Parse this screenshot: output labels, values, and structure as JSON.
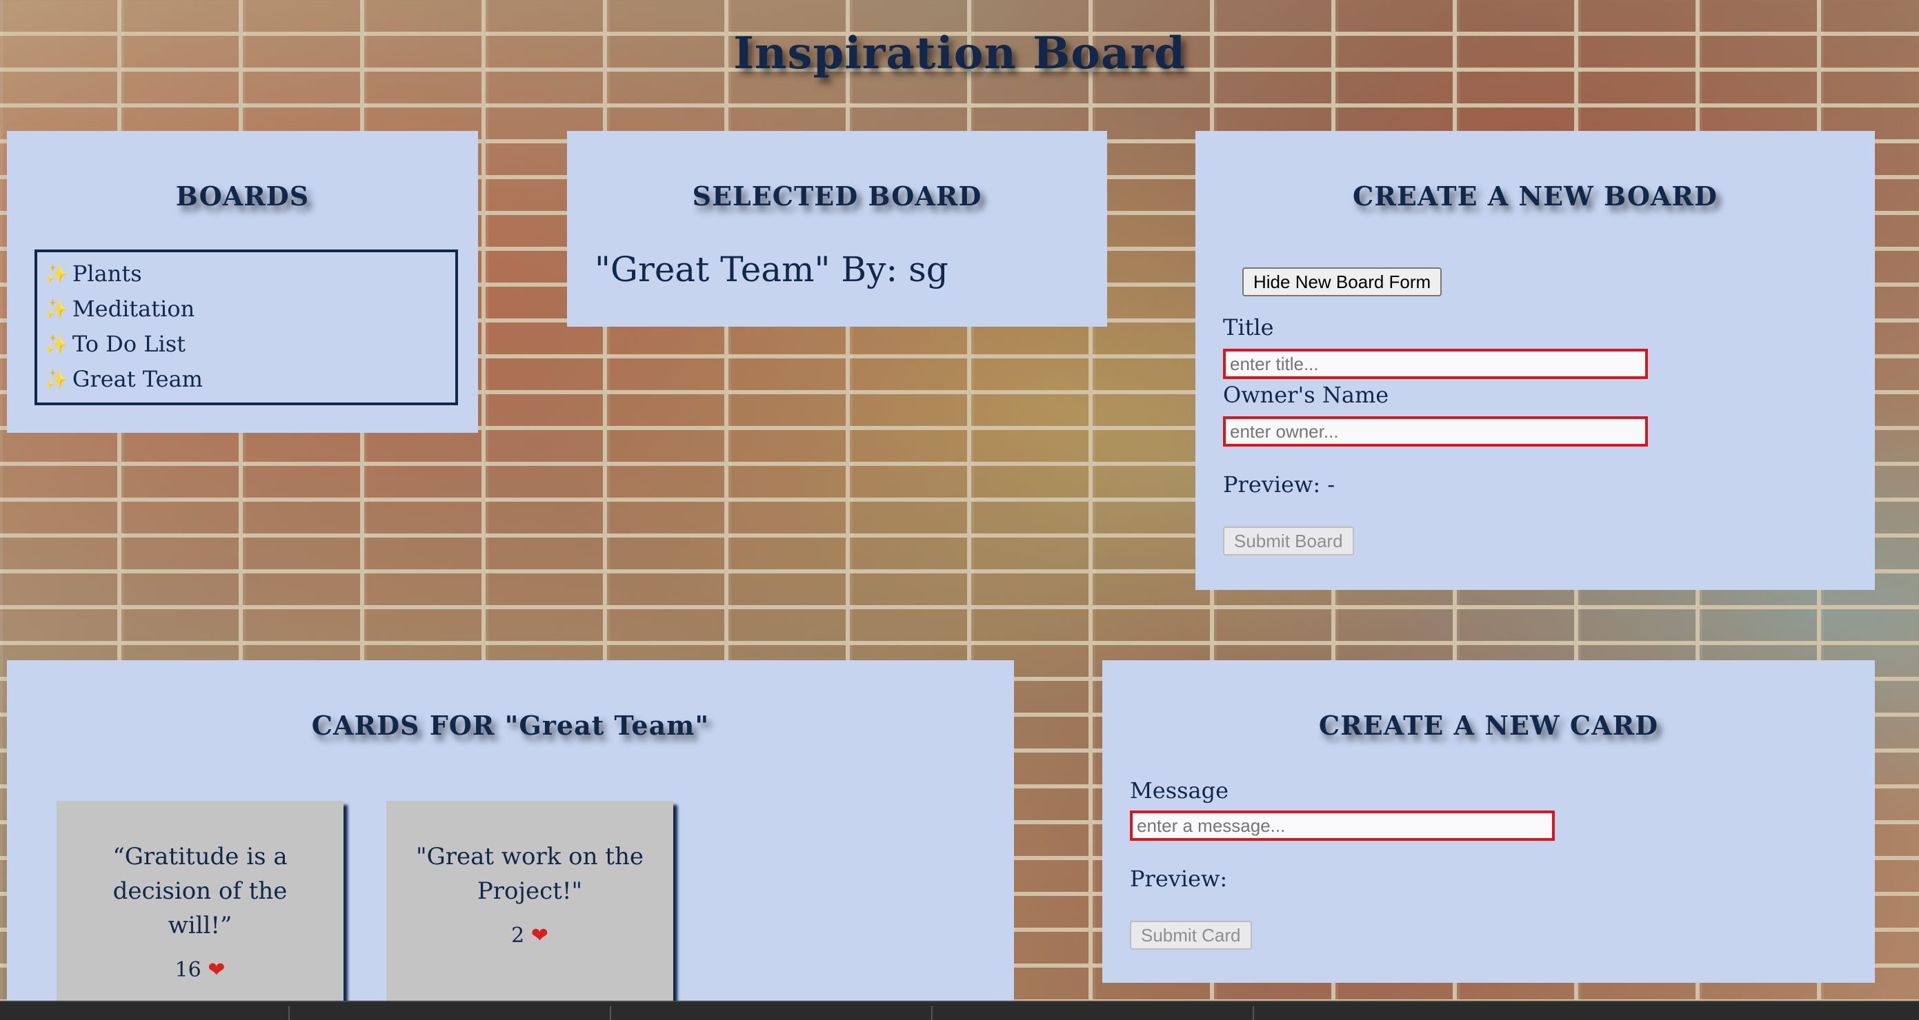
{
  "app_title": "Inspiration Board",
  "boards_panel": {
    "heading": "BOARDS",
    "items": [
      {
        "icon": "sparkles-icon",
        "label": "Plants"
      },
      {
        "icon": "sparkles-icon",
        "label": "Meditation"
      },
      {
        "icon": "sparkles-icon",
        "label": "To Do List"
      },
      {
        "icon": "sparkles-icon",
        "label": "Great Team"
      }
    ]
  },
  "selected_panel": {
    "heading": "SELECTED BOARD",
    "text": "\"Great Team\" By: sg"
  },
  "create_board": {
    "heading": "CREATE A NEW BOARD",
    "toggle_label": "Hide New Board Form",
    "title_label": "Title",
    "title_value": "",
    "title_placeholder": "enter title...",
    "owner_label": "Owner's Name",
    "owner_value": "",
    "owner_placeholder": "enter owner...",
    "preview": "Preview: -",
    "submit_label": "Submit Board"
  },
  "cards_panel": {
    "heading": "CARDS FOR \"Great Team\"",
    "cards": [
      {
        "message": "“Gratitude is a decision of the will!”",
        "likes": "16",
        "like_icon": "heart-icon"
      },
      {
        "message": "\"Great work on the Project!\"",
        "likes": "2",
        "like_icon": "heart-icon"
      }
    ]
  },
  "create_card": {
    "heading": "CREATE A NEW CARD",
    "message_label": "Message",
    "message_value": "",
    "message_placeholder": "enter a message...",
    "preview": "Preview:",
    "submit_label": "Submit Card"
  },
  "colors": {
    "panel": "#c6d4f0",
    "text": "#12284a",
    "card": "#c4c4c4",
    "input_border": "#d7191c"
  }
}
